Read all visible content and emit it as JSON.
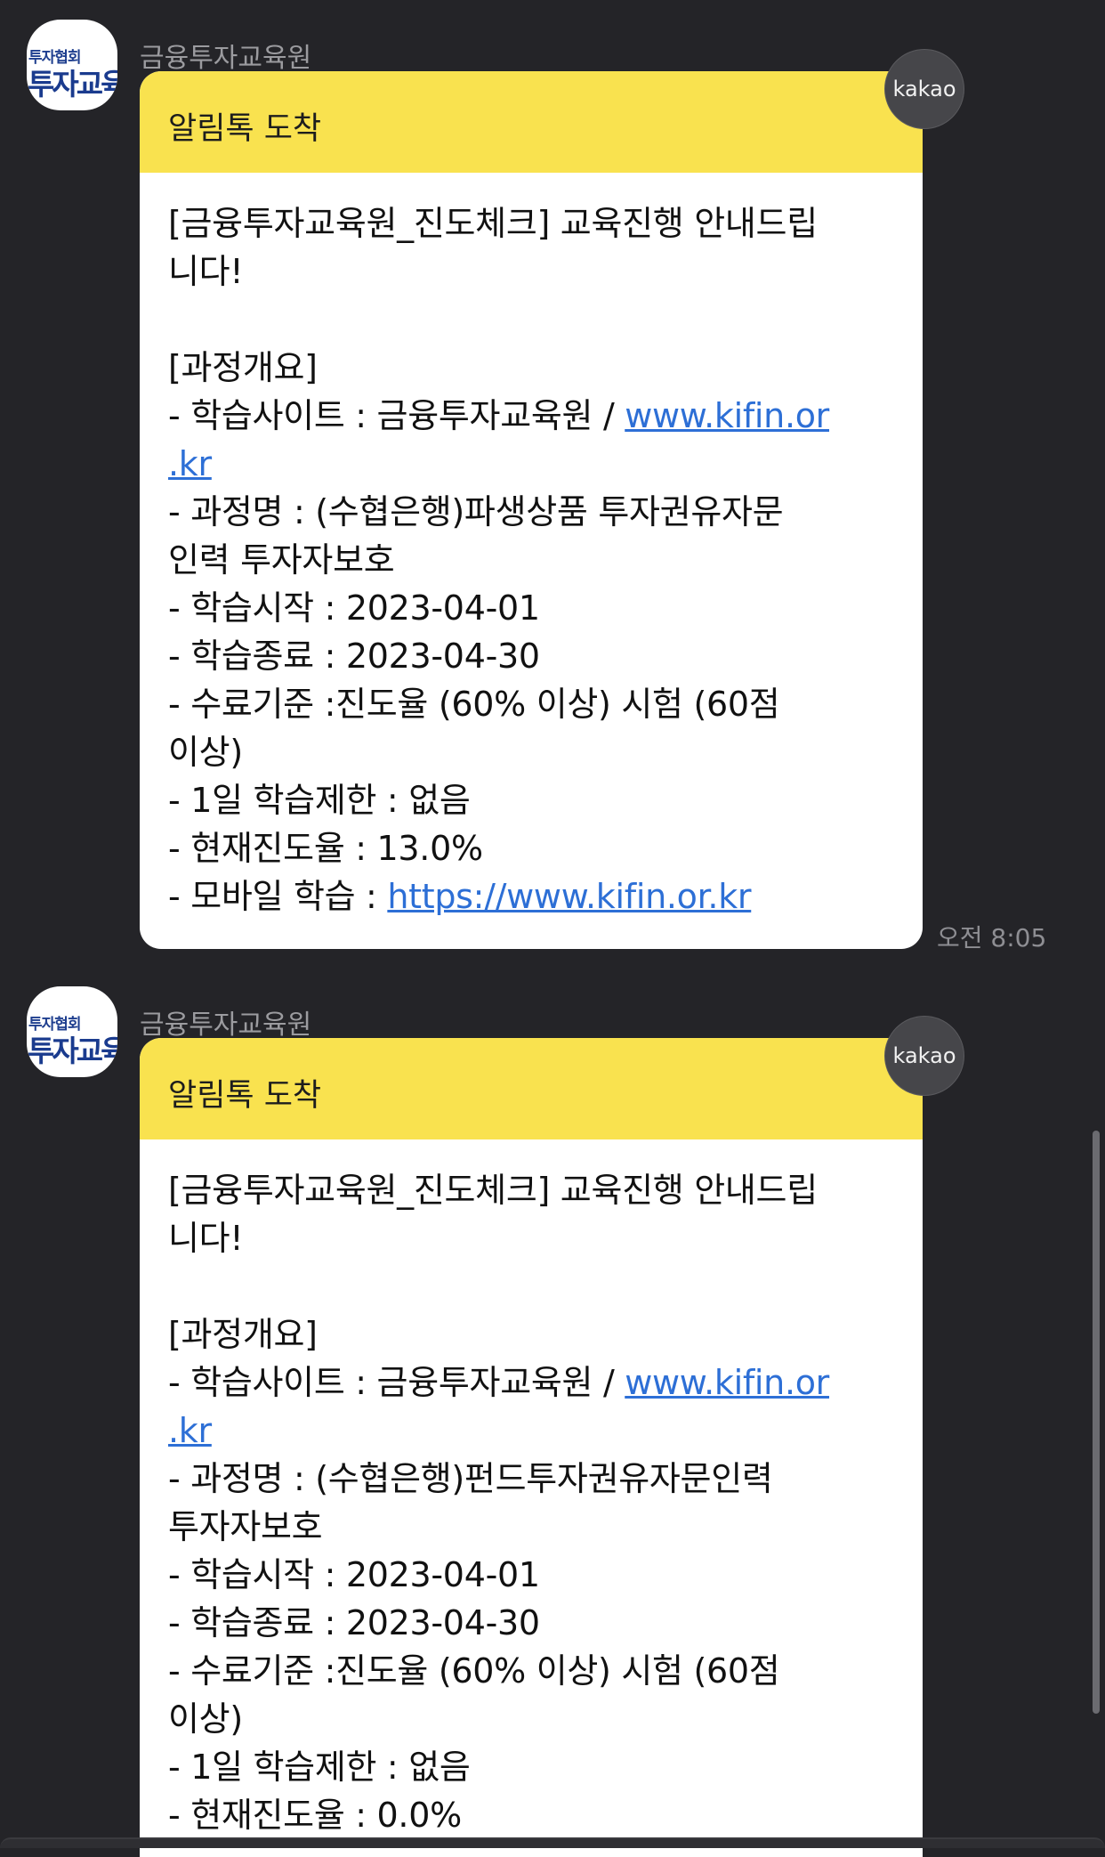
{
  "messages": [
    {
      "sender": "금융투자교육원",
      "avatar_text_small": "투자협회",
      "avatar_text_big": "투자교육",
      "badge": "kakao",
      "header": "알림톡 도착",
      "lines": {
        "l1": "[금융투자교육원_진도체크] 교육진행 안내드립",
        "l2": "니다!",
        "l3": "[과정개요]",
        "l4a": "- 학습사이트 : 금융투자교육원 / ",
        "l4link": "www.kifin.or",
        "l5link": ".kr",
        "l6": "- 과정명 :   (수협은행)파생상품 투자권유자문",
        "l7": "인력 투자자보호",
        "l8": "- 학습시작 : 2023-04-01",
        "l9": "- 학습종료 : 2023-04-30",
        "l10": "- 수료기준 :진도율 (60% 이상) 시험 (60점",
        "l11": "이상)",
        "l12": "- 1일 학습제한 : 없음",
        "l13": "- 현재진도율 : 13.0%",
        "l14a": "- 모바일 학습 : ",
        "l14link": "https://www.kifin.or.kr"
      },
      "time": "오전 8:05"
    },
    {
      "sender": "금융투자교육원",
      "avatar_text_small": "투자협회",
      "avatar_text_big": "투자교육",
      "badge": "kakao",
      "header": "알림톡 도착",
      "lines": {
        "l1": "[금융투자교육원_진도체크] 교육진행 안내드립",
        "l2": "니다!",
        "l3": "[과정개요]",
        "l4a": "- 학습사이트 : 금융투자교육원 / ",
        "l4link": "www.kifin.or",
        "l5link": ".kr",
        "l6": "- 과정명 :   (수협은행)펀드투자권유자문인력",
        "l7": "투자자보호",
        "l8": "- 학습시작 : 2023-04-01",
        "l9": "- 학습종료 : 2023-04-30",
        "l10": "- 수료기준 :진도율 (60% 이상) 시험 (60점",
        "l11": "이상)",
        "l12": "- 1일 학습제한 : 없음",
        "l13": "- 현재진도율 : 0.0%"
      }
    }
  ],
  "colors": {
    "background": "#242428",
    "bubble_header": "#f9e24f",
    "link": "#2d6fd6"
  }
}
